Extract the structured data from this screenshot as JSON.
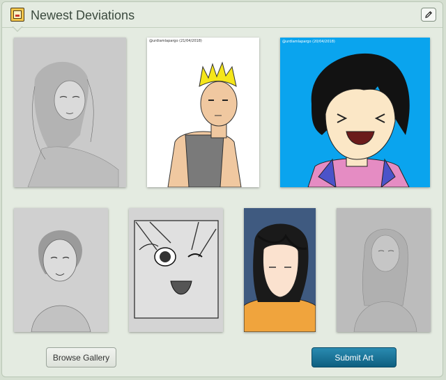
{
  "widget": {
    "title": "Newest Deviations",
    "icon": "gallery-icon",
    "edit_icon": "pencil-icon"
  },
  "thumbnails": [
    {
      "name": "deviation-thumb-1",
      "caption": ""
    },
    {
      "name": "deviation-thumb-2",
      "caption": "@urdiamlapargo (21/04/2018)"
    },
    {
      "name": "deviation-thumb-3",
      "caption": "@urdiamlapargo (20/04/2018)"
    },
    {
      "name": "deviation-thumb-4",
      "caption": ""
    },
    {
      "name": "deviation-thumb-5",
      "caption": ""
    },
    {
      "name": "deviation-thumb-6",
      "caption": ""
    },
    {
      "name": "deviation-thumb-7",
      "caption": ""
    }
  ],
  "buttons": {
    "browse_gallery": "Browse Gallery",
    "submit_art": "Submit Art"
  },
  "colors": {
    "accent": "#0e5f80",
    "panel": "#e4ebe1"
  }
}
